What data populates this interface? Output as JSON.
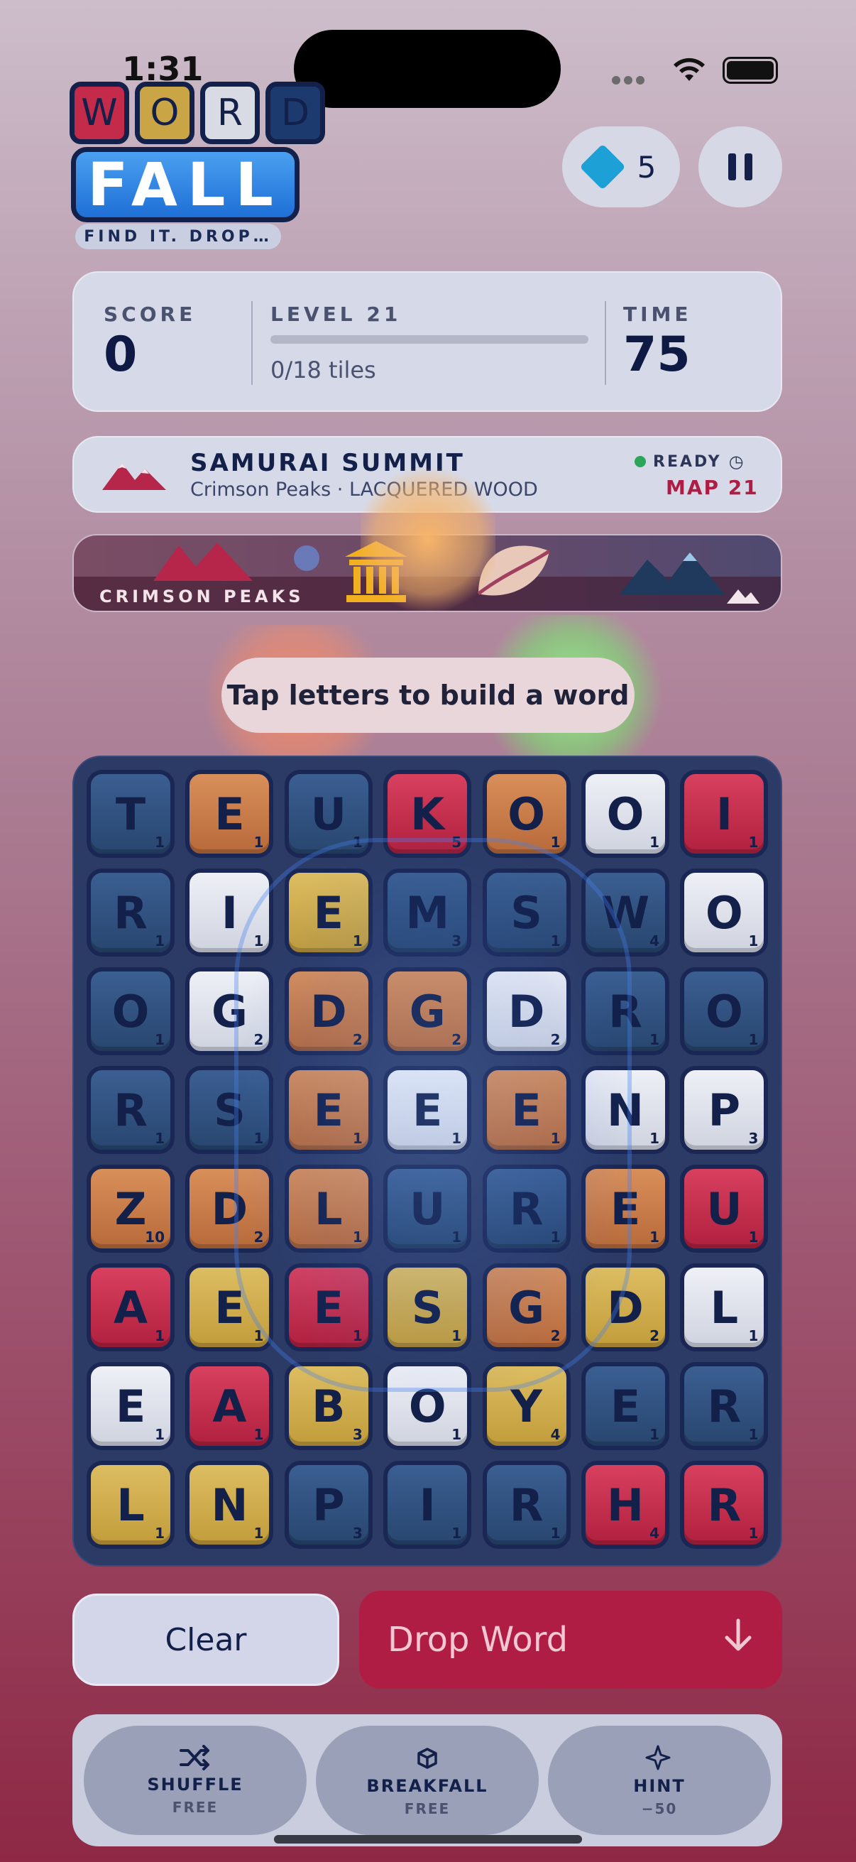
{
  "status": {
    "time": "1:31"
  },
  "logo": {
    "word_letters": [
      "W",
      "O",
      "R",
      "D"
    ],
    "word_colors": [
      "#c42a4a",
      "#c9a545",
      "#d9dbe4",
      "#1c3a6e"
    ],
    "fall": "FALL",
    "tagline": "FIND IT. DROP…"
  },
  "gems": {
    "count": "5",
    "icon": "diamond-icon"
  },
  "pause": {
    "icon": "pause-icon"
  },
  "stats": {
    "score_label": "SCORE",
    "score_value": "0",
    "level_label": "LEVEL 21",
    "tiles_text": "0/18 tiles",
    "tiles_progress": 0,
    "time_label": "TIME",
    "time_value": "75"
  },
  "map": {
    "title": "SAMURAI SUMMIT",
    "subtitle": "Crimson Peaks · LACQUERED WOOD",
    "status": "READY",
    "map_label": "MAP 21"
  },
  "strip": {
    "label": "CRIMSON PEAKS"
  },
  "hint_text": "Tap letters to build a word",
  "colors": {
    "red": "#c42a4a",
    "gold": "#c9a545",
    "white": "#dadce6",
    "blue": "#2d4f7e",
    "orange": "#c97a45"
  },
  "grid": [
    [
      [
        "T",
        "1",
        "blue"
      ],
      [
        "E",
        "1",
        "orange"
      ],
      [
        "U",
        "1",
        "blue"
      ],
      [
        "K",
        "5",
        "red"
      ],
      [
        "O",
        "1",
        "orange"
      ],
      [
        "O",
        "1",
        "white"
      ],
      [
        "I",
        "1",
        "red"
      ]
    ],
    [
      [
        "R",
        "1",
        "blue"
      ],
      [
        "I",
        "1",
        "white"
      ],
      [
        "E",
        "1",
        "gold"
      ],
      [
        "M",
        "3",
        "blue"
      ],
      [
        "S",
        "1",
        "blue"
      ],
      [
        "W",
        "4",
        "blue"
      ],
      [
        "O",
        "1",
        "white"
      ]
    ],
    [
      [
        "O",
        "1",
        "blue"
      ],
      [
        "G",
        "2",
        "white"
      ],
      [
        "D",
        "2",
        "orange"
      ],
      [
        "G",
        "2",
        "orange"
      ],
      [
        "D",
        "2",
        "white"
      ],
      [
        "R",
        "1",
        "blue"
      ],
      [
        "O",
        "1",
        "blue"
      ]
    ],
    [
      [
        "R",
        "1",
        "blue"
      ],
      [
        "S",
        "1",
        "blue"
      ],
      [
        "E",
        "1",
        "orange"
      ],
      [
        "E",
        "1",
        "white"
      ],
      [
        "E",
        "1",
        "orange"
      ],
      [
        "N",
        "1",
        "white"
      ],
      [
        "P",
        "3",
        "white"
      ]
    ],
    [
      [
        "Z",
        "10",
        "orange"
      ],
      [
        "D",
        "2",
        "orange"
      ],
      [
        "L",
        "1",
        "orange"
      ],
      [
        "U",
        "1",
        "blue"
      ],
      [
        "R",
        "1",
        "blue"
      ],
      [
        "E",
        "1",
        "orange"
      ],
      [
        "U",
        "1",
        "red"
      ]
    ],
    [
      [
        "A",
        "1",
        "red"
      ],
      [
        "E",
        "1",
        "gold"
      ],
      [
        "E",
        "1",
        "red"
      ],
      [
        "S",
        "1",
        "gold"
      ],
      [
        "G",
        "2",
        "orange"
      ],
      [
        "D",
        "2",
        "gold"
      ],
      [
        "L",
        "1",
        "white"
      ]
    ],
    [
      [
        "E",
        "1",
        "white"
      ],
      [
        "A",
        "1",
        "red"
      ],
      [
        "B",
        "3",
        "gold"
      ],
      [
        "O",
        "1",
        "white"
      ],
      [
        "Y",
        "4",
        "gold"
      ],
      [
        "E",
        "1",
        "blue"
      ],
      [
        "R",
        "1",
        "blue"
      ]
    ],
    [
      [
        "L",
        "1",
        "gold"
      ],
      [
        "N",
        "1",
        "gold"
      ],
      [
        "P",
        "3",
        "blue"
      ],
      [
        "I",
        "1",
        "blue"
      ],
      [
        "R",
        "1",
        "blue"
      ],
      [
        "H",
        "4",
        "red"
      ],
      [
        "R",
        "1",
        "red"
      ]
    ]
  ],
  "buttons": {
    "clear": "Clear",
    "drop": "Drop Word"
  },
  "tools": [
    {
      "label": "SHUFFLE",
      "cost": "FREE",
      "icon": "shuffle-icon"
    },
    {
      "label": "BREAKFALL",
      "cost": "FREE",
      "icon": "cubes-icon"
    },
    {
      "label": "HINT",
      "cost": "−50",
      "icon": "sparkle-icon"
    }
  ]
}
